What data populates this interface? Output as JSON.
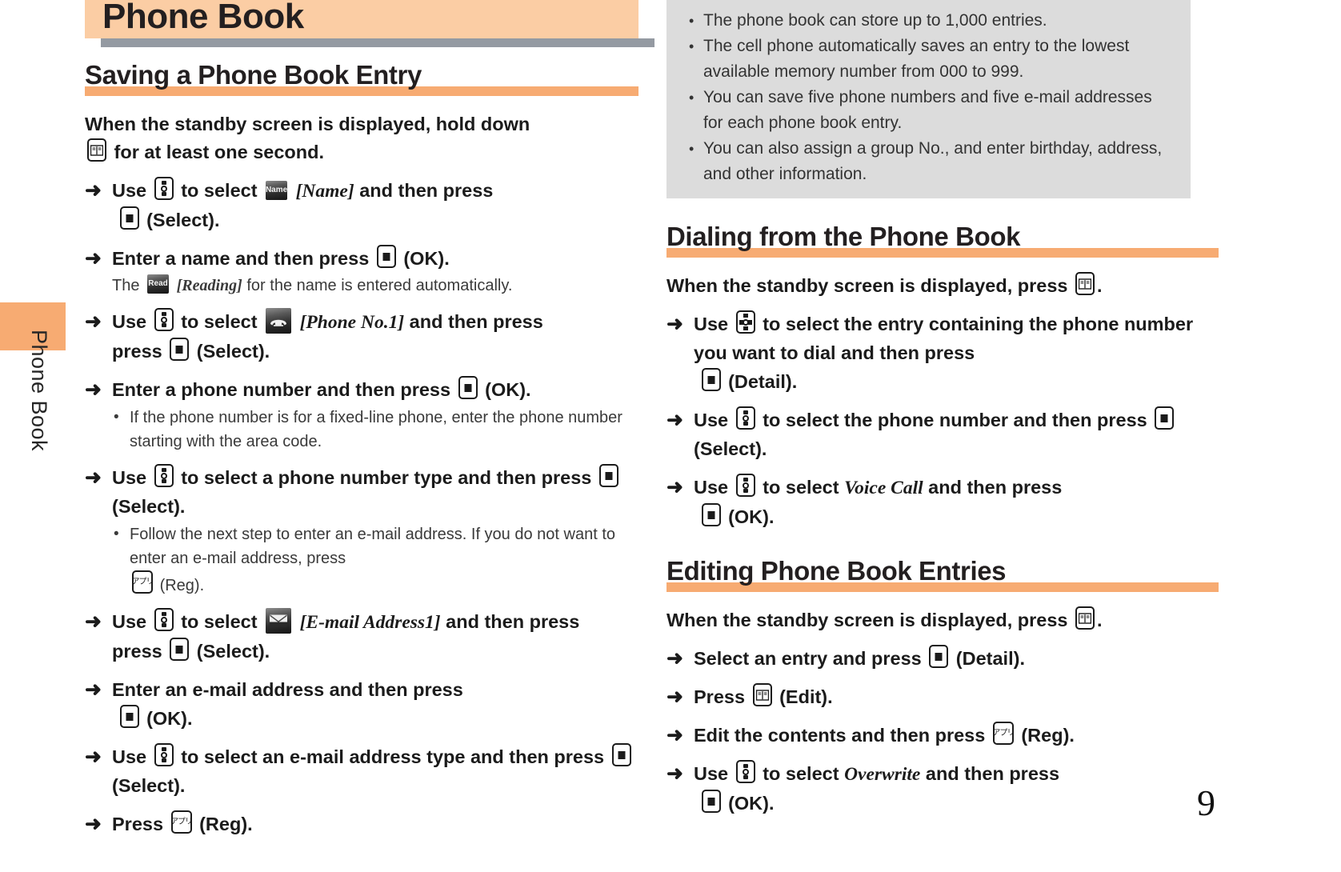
{
  "page": {
    "number": "9",
    "side_tab_label": "Phone Book",
    "title": "Phone Book"
  },
  "colors": {
    "title_band": "#fbcda4",
    "title_shadow": "#949aa2",
    "heading_rule": "#f7ab72",
    "side_tab": "#f7ab72",
    "infobox_bg": "#dcdcdc"
  },
  "left_column": {
    "heading": "Saving a Phone Book Entry",
    "lead_a": "When the standby screen is displayed, hold down",
    "lead_b": "for at least one second.",
    "steps": {
      "s1_a": "Use",
      "s1_b": "to select",
      "s1_badge": "Name",
      "s1_italic": "[Name]",
      "s1_c": "and then press",
      "s1_d": "(Select).",
      "s2_a": "Enter a name and then press",
      "s2_b": "(OK).",
      "s2_note_a": "The",
      "s2_note_badge": "Read",
      "s2_note_italic": "[Reading]",
      "s2_note_b": "for the name is entered automatically.",
      "s3_a": "Use",
      "s3_b": "to select",
      "s3_italic": "[Phone No.1]",
      "s3_c": "and then press",
      "s3_d": "(Select).",
      "s4_a": "Enter a phone number and then press",
      "s4_b": "(OK).",
      "s4_bullet": "If the phone number is for a fixed-line phone, enter the phone number starting with the area code.",
      "s5_a": "Use",
      "s5_b": "to select a phone number type and then press",
      "s5_c": "(Select).",
      "s5_bullet_a": "Follow the next step to enter an e-mail address. If you do not want to enter an e-mail address, press",
      "s5_bullet_b": "(Reg).",
      "s6_a": "Use",
      "s6_b": "to select",
      "s6_italic": "[E-mail Address1]",
      "s6_c": "and then press",
      "s6_d": "(Select).",
      "s7_a": "Enter an e-mail address and then press",
      "s7_b": "(OK).",
      "s8_a": "Use",
      "s8_b": "to select an e-mail address type and then press",
      "s8_c": "(Select).",
      "s9_a": "Press",
      "s9_b": "(Reg)."
    }
  },
  "right_column": {
    "infobox_items": [
      "The phone book can store up to 1,000 entries.",
      "The cell phone automatically saves an entry to the lowest available memory number from 000 to 999.",
      "You can save five phone numbers and five e-mail addresses for each phone book entry.",
      "You can also assign a group No., and enter birthday, address, and other information."
    ],
    "dialing": {
      "heading": "Dialing from the Phone Book",
      "lead_a": "When the standby screen is displayed, press",
      "lead_b": ".",
      "d1_a": "Use",
      "d1_b": "to select the entry containing the phone number you want to dial and then press",
      "d1_c": "(Detail).",
      "d2_a": "Use",
      "d2_b": "to select the phone number and then press",
      "d2_c": "(Select).",
      "d3_a": "Use",
      "d3_b": "to select",
      "d3_italic": "Voice Call",
      "d3_c": "and then press",
      "d3_d": "(OK)."
    },
    "editing": {
      "heading": "Editing Phone Book Entries",
      "lead_a": "When the standby screen is displayed, press",
      "lead_b": ".",
      "e1_a": "Select an entry and press",
      "e1_b": "(Detail).",
      "e2_a": "Press",
      "e2_b": "(Edit).",
      "e3_a": "Edit the contents and then press",
      "e3_b": "(Reg).",
      "e4_a": "Use",
      "e4_b": "to select",
      "e4_italic": "Overwrite",
      "e4_c": "and then press",
      "e4_d": "(OK)."
    }
  },
  "icons": {
    "arrow": "➜",
    "bullet": "•",
    "app_key_label": "アプリ"
  }
}
